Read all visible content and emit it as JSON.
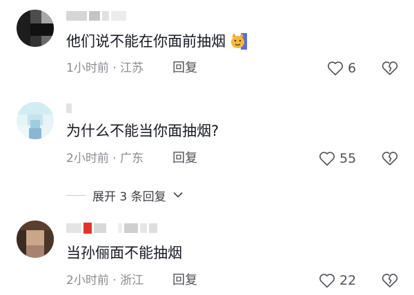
{
  "comments": [
    {
      "text": "他们说不能在你面前抽烟",
      "time": "1小时前",
      "location": "江苏",
      "reply_label": "回复",
      "likes": "6",
      "emoji": "cat-face-emoji"
    },
    {
      "text": "为什么不能当你面抽烟?",
      "time": "2小时前",
      "location": "广东",
      "reply_label": "回复",
      "likes": "55"
    },
    {
      "text": "当孙俪面不能抽烟",
      "time": "2小时前",
      "location": "浙江",
      "reply_label": "回复",
      "likes": "22"
    }
  ],
  "expand_replies": {
    "label": "展开 3 条回复"
  },
  "separator": "·",
  "colors": {
    "text": "#161823",
    "meta": "#8a8b91",
    "icon": "#4f5058",
    "blur_dark": "#2b2b2b",
    "blur_light": "#b7dbe6",
    "blur_red": "#e4312b"
  }
}
